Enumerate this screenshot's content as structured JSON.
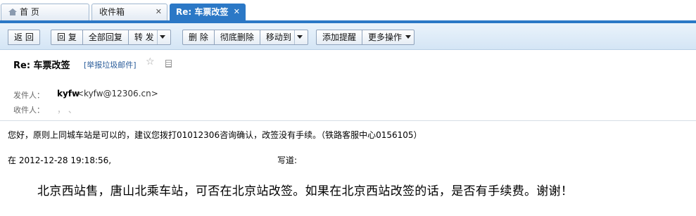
{
  "tabs": [
    {
      "label": "首 页",
      "icon": "home-icon"
    },
    {
      "label": "收件箱",
      "close": "✕"
    },
    {
      "label": "Re: 车票改签",
      "close": "✕",
      "active": true
    }
  ],
  "toolbar": {
    "back": "返 回",
    "reply": "回 复",
    "reply_all": "全部回复",
    "forward": "转 发",
    "delete": "删 除",
    "delete_perm": "彻底删除",
    "move_to": "移动到",
    "add_reminder": "添加提醒",
    "more_actions": "更多操作"
  },
  "message": {
    "subject": "Re: 车票改签",
    "report_spam": "[举报垃圾邮件]",
    "from_label": "发件人：",
    "from_name": "kyfw",
    "from_email": "<kyfw@12306.cn>",
    "to_label": "收件人：",
    "to_value": "，                                    、",
    "reply_text": "您好，原则上同城车站是可以的，建议您拨打01012306咨询确认，改签没有手续。（铁路客服中心0156105）",
    "quote_date": "在 2012-12-28 19:18:56,",
    "quote_wrote": "写道:",
    "quote_body": "北京西站售，唐山北乘车站，可否在北京站改签。如果在北京西站改签的话，是否有手续费。谢谢！"
  },
  "colors": {
    "accent": "#2b78c6",
    "toolbar_bg": "#dbe9f6",
    "link": "#2a5c9a"
  }
}
